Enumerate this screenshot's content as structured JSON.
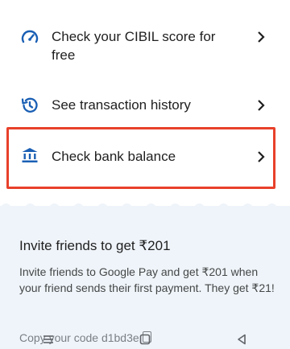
{
  "menu": {
    "cibil_label": "Check your CIBIL score for free",
    "history_label": "See transaction history",
    "balance_label": "Check bank balance"
  },
  "invite": {
    "title": "Invite friends to get ₹201",
    "description": "Invite friends to Google Pay and get ₹201 when your friend sends their first payment. They get ₹21!",
    "copy_code": "Copy your code d1bd3e"
  },
  "colors": {
    "accent": "#1a5fb4",
    "highlight": "#e8412b",
    "invite_bg": "#eff4fa"
  },
  "icons": {
    "cibil": "speedometer-icon",
    "history": "history-icon",
    "balance": "bank-icon",
    "chevron": "chevron-right-icon"
  }
}
